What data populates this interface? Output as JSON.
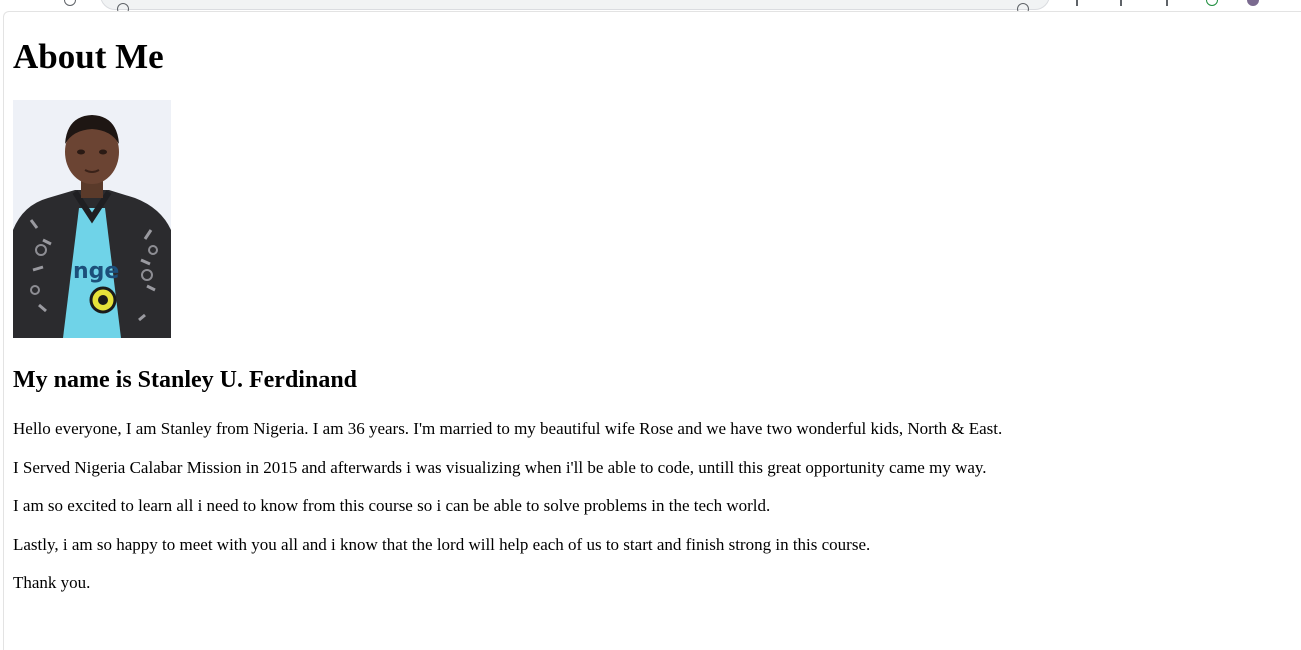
{
  "page": {
    "heading": "About Me",
    "photo_alt": "Portrait photo",
    "subheading": "My name is Stanley U. Ferdinand",
    "paragraphs": [
      "Hello everyone, I am Stanley from Nigeria. I am 36 years. I'm married to my beautiful wife Rose and we have two wonderful kids, North & East.",
      "I Served Nigeria Calabar Mission in 2015 and afterwards i was visualizing when i'll be able to code, untill this great opportunity came my way.",
      "I am so excited to learn all i need to know from this course so i can be able to solve problems in the tech world.",
      "Lastly, i am so happy to meet with you all and i know that the lord will help each of us to start and finish strong in this course.",
      "Thank you."
    ]
  },
  "colors": {
    "text": "#000000",
    "background": "#ffffff",
    "jacket": "#2b2b2e",
    "shirt": "#6fd3e8",
    "photo_bg": "#eef1f7"
  },
  "icons": [
    "info-icon",
    "bookmark-star-icon",
    "extensions-icon",
    "profile-avatar-icon"
  ]
}
